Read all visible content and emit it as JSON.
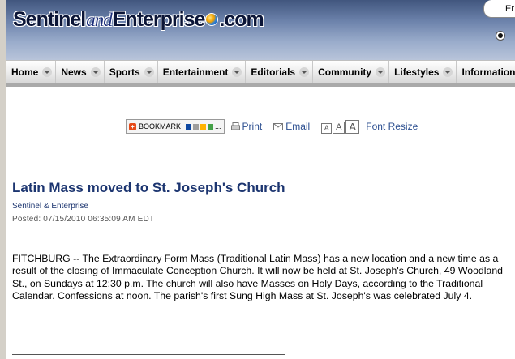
{
  "site": {
    "logo_part1": "Sentinel",
    "logo_and": "and",
    "logo_part2": "Enterprise",
    "logo_tld": ".com",
    "search_text": "Er"
  },
  "nav": [
    {
      "label": "Home"
    },
    {
      "label": "News"
    },
    {
      "label": "Sports"
    },
    {
      "label": "Entertainment"
    },
    {
      "label": "Editorials"
    },
    {
      "label": "Community"
    },
    {
      "label": "Lifestyles"
    },
    {
      "label": "Information"
    }
  ],
  "tools": {
    "bookmark": "BOOKMARK",
    "print": "Print",
    "email": "Email",
    "font_resize": "Font Resize"
  },
  "article": {
    "title": "Latin Mass moved to St. Joseph's Church",
    "byline": "Sentinel & Enterprise",
    "posted": "Posted: 07/15/2010 06:35:09 AM EDT",
    "body": "FITCHBURG -- The Extraordinary Form Mass (Traditional Latin Mass) has a new location and a new time as a result of the closing of Immaculate Conception Church. It will now be held at St. Joseph's Church, 49 Woodland St., on Sundays at 12:30 p.m. The church will also have Masses on Holy Days, according to the Traditional Calendar. Confessions at noon. The parish's first Sung High Mass at St. Joseph's was celebrated July 4."
  }
}
